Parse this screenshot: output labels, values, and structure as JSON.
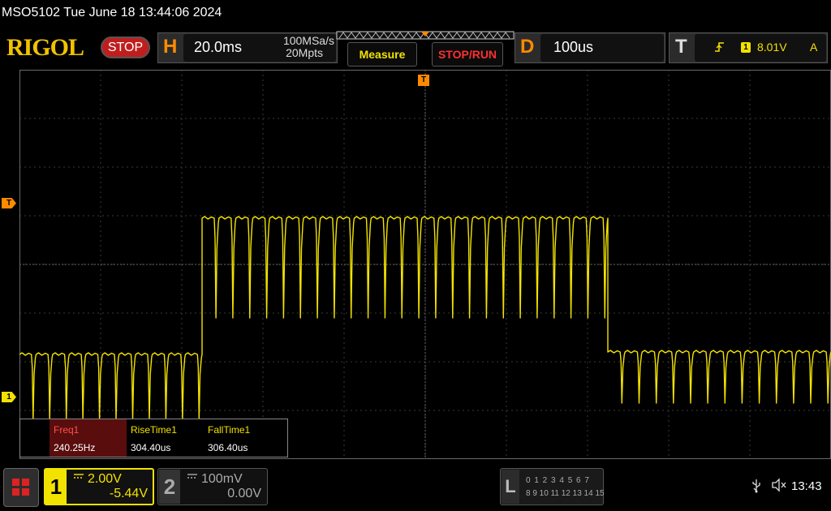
{
  "title_bar": {
    "text": "MSO5102  Tue June 18 13:44:06 2024"
  },
  "toolbar": {
    "brand": "RIGOL",
    "run_state": "STOP",
    "horizontal": {
      "letter": "H",
      "timebase": "20.0ms",
      "sample_rate": "100MSa/s",
      "memory_depth": "20Mpts"
    },
    "measure_label": "Measure",
    "stop_run_label": "STOP/RUN",
    "delayed": {
      "letter": "D",
      "value": "100us"
    },
    "trigger": {
      "letter": "T",
      "edge_icon": "rising-edge-icon",
      "source": "1",
      "level": "8.01V",
      "mode": "A"
    }
  },
  "markers": {
    "trigger_level": "T",
    "channel1": "1",
    "trigger_position": "T"
  },
  "measurements": [
    {
      "name": "Freq1",
      "value": "240.25Hz"
    },
    {
      "name": "RiseTime1",
      "value": "304.40us"
    },
    {
      "name": "FallTime1",
      "value": "306.40us"
    }
  ],
  "channels": [
    {
      "number": "1",
      "coupling_icon": "dc-coupling-icon",
      "scale": "2.00V",
      "offset": "-5.44V",
      "color": "#f2e200",
      "active": true
    },
    {
      "number": "2",
      "coupling_icon": "dc-coupling-icon",
      "scale": "100mV",
      "offset": "0.00V",
      "color": "#aaaaaa",
      "active": false
    }
  ],
  "logic_analyzer": {
    "letter": "L",
    "row1": "0 1 2 3  4 5 6 7",
    "row2": "8 9 10 11 12 13 14 15"
  },
  "status": {
    "usb_icon": "usb-icon",
    "speaker_icon": "speaker-muted-icon",
    "clock": "13:43"
  },
  "colors": {
    "accent_orange": "#ff8a00",
    "trace_yellow": "#f2e200",
    "stop_red": "#c01e1e",
    "measure_label_red": "#ff5050"
  },
  "chart_data": {
    "type": "line",
    "title": "",
    "xlabel": "",
    "ylabel": "",
    "horizontal_divisions": 10,
    "vertical_divisions": 8,
    "grid": true,
    "series": [
      {
        "segments": [
          {
            "x_div": [
              0.0,
              2.25
            ],
            "high_div": 2.15,
            "low_div": 0.8,
            "pulses": 11
          },
          {
            "x_div": [
              2.25,
              7.25
            ],
            "high_div": 4.95,
            "low_div": 2.9,
            "pulses": 24
          },
          {
            "x_div": [
              7.25,
              10.0
            ],
            "high_div": 2.2,
            "low_div": 1.15,
            "pulses": 13
          }
        ]
      }
    ]
  }
}
